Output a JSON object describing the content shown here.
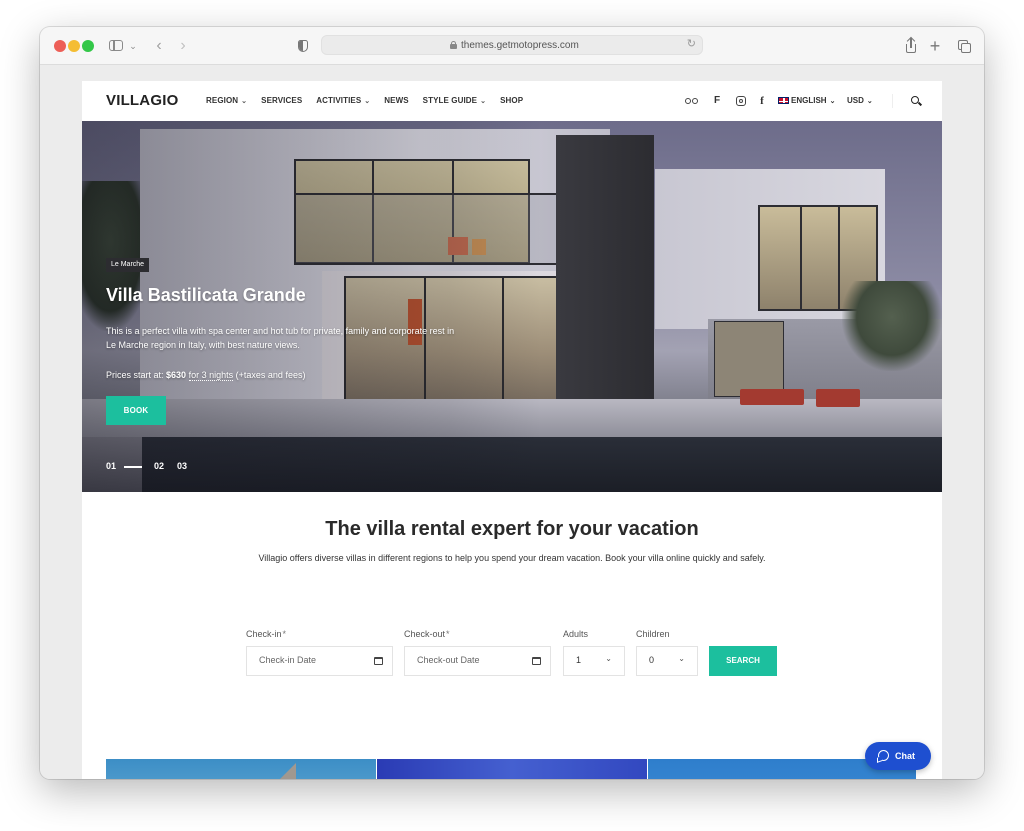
{
  "browser": {
    "url": "themes.getmotopress.com"
  },
  "header": {
    "logo": "VILLAGIO",
    "nav": [
      {
        "label": "REGION",
        "dropdown": true
      },
      {
        "label": "SERVICES",
        "dropdown": false
      },
      {
        "label": "ACTIVITIES",
        "dropdown": true
      },
      {
        "label": "NEWS",
        "dropdown": false
      },
      {
        "label": "STYLE GUIDE",
        "dropdown": true
      },
      {
        "label": "SHOP",
        "dropdown": false
      }
    ],
    "social_icons": [
      "tripadvisor-icon",
      "foursquare-icon",
      "instagram-icon",
      "facebook-icon"
    ],
    "facebook_glyph": "f",
    "foursquare_glyph": "F",
    "language": "ENGLISH",
    "currency": "USD",
    "chevron": "⌄"
  },
  "hero": {
    "region_badge": "Le Marche",
    "title": "Villa Bastilicata Grande",
    "description": "This is a perfect villa with spa center and hot tub for private, family and corporate rest in Le Marche region in Italy, with best nature views.",
    "price_prefix": "Prices start at:",
    "price": "$630",
    "price_for": "for",
    "price_nights": "3 nights",
    "price_suffix": "(+taxes and fees)",
    "book_label": "BOOK",
    "slides": [
      "01",
      "02",
      "03"
    ],
    "active_slide": "01"
  },
  "intro": {
    "title": "The villa rental expert for your vacation",
    "text": "Villagio offers diverse  villas in different regions to help you spend your dream vacation. Book your villa online quickly and safely."
  },
  "booking_form": {
    "checkin_label": "Check-in",
    "checkin_placeholder": "Check-in Date",
    "checkout_label": "Check-out",
    "checkout_placeholder": "Check-out Date",
    "required_mark": "*",
    "adults_label": "Adults",
    "adults_value": "1",
    "children_label": "Children",
    "children_value": "0",
    "search_label": "SEARCH"
  },
  "colors": {
    "accent": "#1cbf9e",
    "chat": "#1e4fd0"
  },
  "chat": {
    "label": "Chat"
  }
}
